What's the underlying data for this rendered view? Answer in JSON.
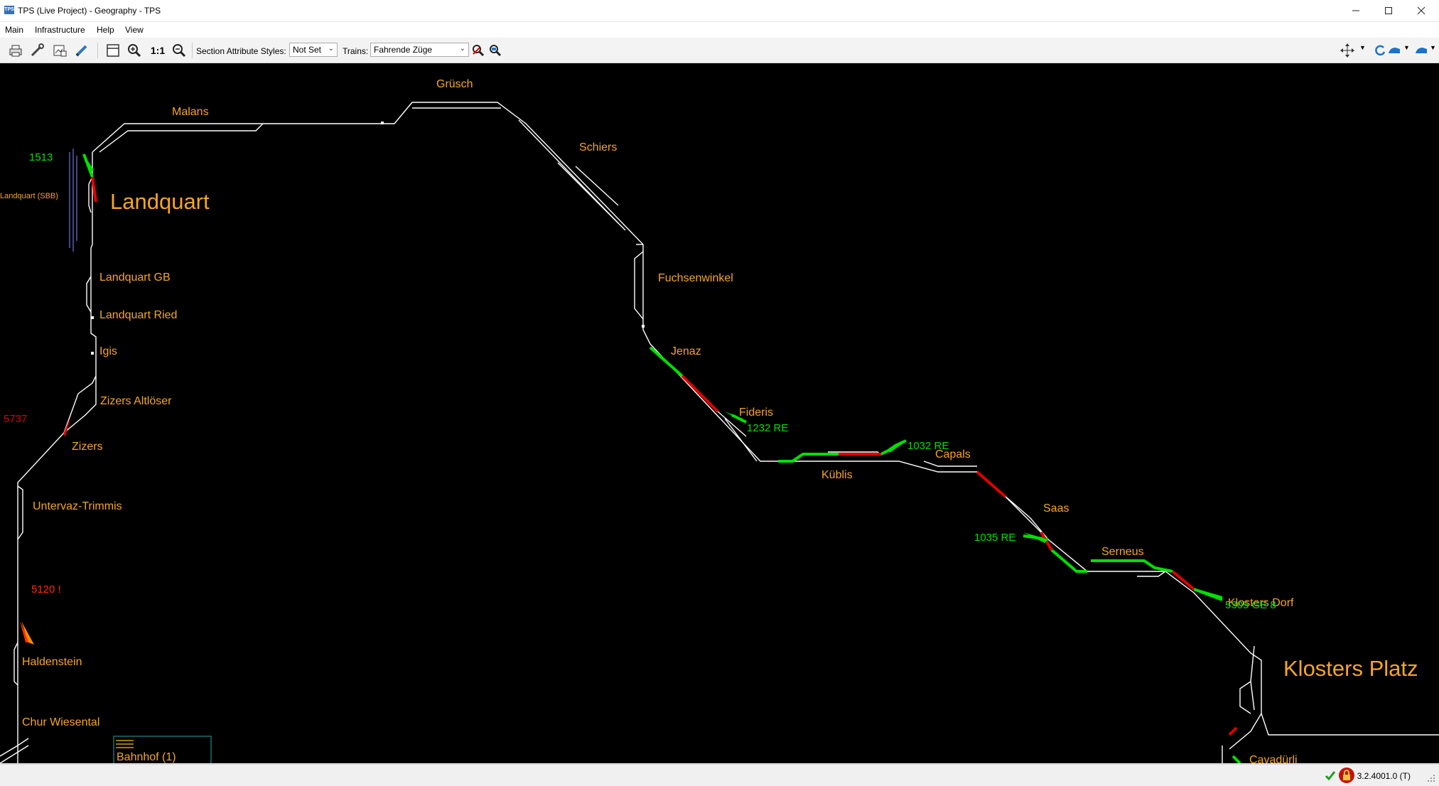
{
  "window": {
    "title": "TPS (Live Project) - Geography - TPS",
    "app_icon_text": "TPS"
  },
  "menu": [
    "Main",
    "Infrastructure",
    "Help",
    "View"
  ],
  "toolbar": {
    "zoom_reset_label": "1:1",
    "section_styles_label": "Section Attribute Styles:",
    "section_styles_value": "Not Set",
    "trains_label": "Trains:",
    "trains_value": "Fahrende Züge"
  },
  "map": {
    "stations": {
      "landquart": "Landquart",
      "landquart_sbb": "Landquart (SBB)",
      "malans": "Malans",
      "gruesch": "Grüsch",
      "schiers": "Schiers",
      "fuchsenwinkel": "Fuchsenwinkel",
      "jenaz": "Jenaz",
      "fideris": "Fideris",
      "kueblis": "Küblis",
      "capals": "Capals",
      "saas": "Saas",
      "serneus": "Serneus",
      "klosters_dorf": "Klosters Dorf",
      "klosters_platz": "Klosters Platz",
      "cavadurli": "Cavadürli",
      "landquart_gb": "Landquart GB",
      "landquart_ried": "Landquart Ried",
      "igis": "Igis",
      "zizers_altloser": "Zizers Altlöser",
      "zizers": "Zizers",
      "untervaz": "Untervaz-Trimmis",
      "haldenstein": "Haldenstein",
      "chur_wiesental": "Chur Wiesental"
    },
    "trains": {
      "t1513": "1513",
      "t5737": "5737",
      "t5120": "5120 !",
      "t1232": "1232 RE",
      "t1032": "1032 RE",
      "t1035": "1035 RE",
      "t5305": "5305 GE 8"
    },
    "panel_label": "Bahnhof (1)",
    "colors": {
      "track": "#ffffff",
      "label": "#f5a623",
      "occupied_green": "#00e000",
      "occupied_red": "#e00000",
      "background": "#000000"
    }
  },
  "status": {
    "version": "3.2.4001.0 (T)",
    "ok_icon": "check-icon",
    "lock_icon": "lock-icon"
  }
}
